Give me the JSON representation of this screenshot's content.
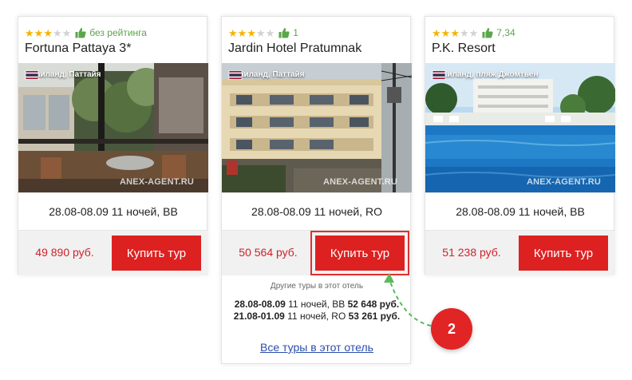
{
  "cards": [
    {
      "stars_on": 3,
      "stars_total": 5,
      "rating": "без рейтинга",
      "name": "Fortuna Pattaya 3*",
      "location": "Таиланд, Паттайя",
      "watermark": "ANEX-AGENT.RU",
      "dates": "28.08-08.09 11 ночей, BB",
      "price": "49 890 руб.",
      "buy_label": "Купить тур"
    },
    {
      "stars_on": 3,
      "stars_total": 5,
      "rating": "1",
      "name": "Jardin Hotel Pratumnak",
      "location": "Таиланд, Паттайя",
      "watermark": "ANEX-AGENT.RU",
      "dates": "28.08-08.09 11 ночей, RO",
      "price": "50 564 руб.",
      "buy_label": "Купить тур",
      "other_tours": {
        "title": "Другие туры в этот отель",
        "rows": [
          {
            "dates": "28.08-08.09",
            "details": " 11 ночей, BB ",
            "price": "52 648 руб."
          },
          {
            "dates": "21.08-01.09",
            "details": " 11 ночей, RO ",
            "price": "53 261 руб."
          }
        ],
        "all_link": "Все туры в этот отель"
      }
    },
    {
      "stars_on": 3,
      "stars_total": 5,
      "rating": "7,34",
      "name": "P.K. Resort",
      "location": "Таиланд, пляж Джомтьен",
      "watermark": "ANEX-AGENT.RU",
      "dates": "28.08-08.09 11 ночей, BB",
      "price": "51 238 руб.",
      "buy_label": "Купить тур"
    }
  ],
  "callout": {
    "number": "2"
  },
  "colors": {
    "accent_red": "#dd2121",
    "price_red": "#d0212a",
    "rating_green": "#5aa64a",
    "star_gold": "#f5b400",
    "link_blue": "#2a4ea8",
    "arrow_green": "#5cb85c"
  },
  "icons": [
    "star-icon",
    "thumbs-up-icon",
    "thailand-flag-icon"
  ]
}
